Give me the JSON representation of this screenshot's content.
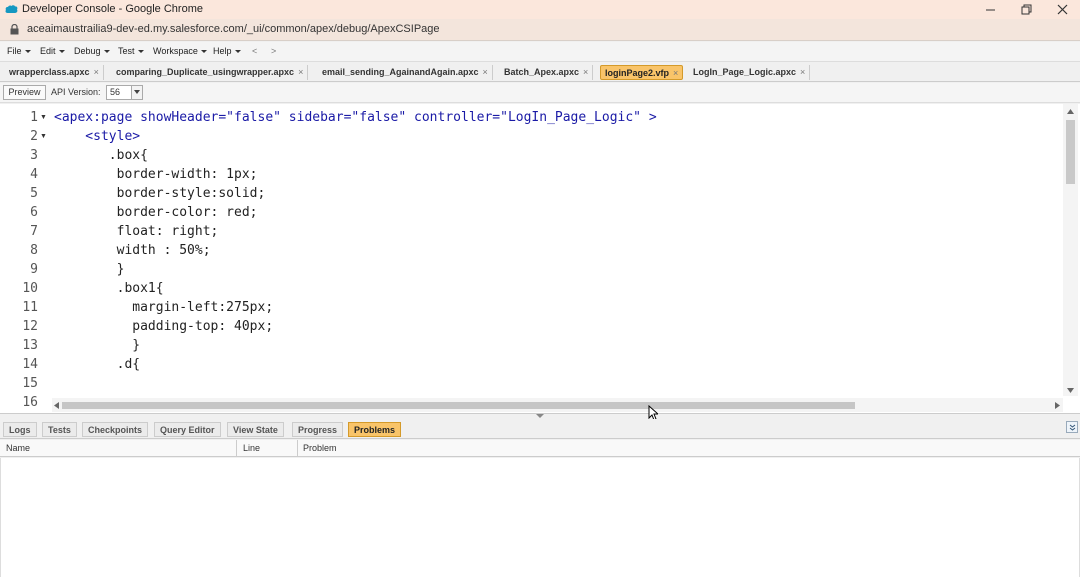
{
  "window": {
    "title": "Developer Console - Google Chrome",
    "url": "aceaimaustrailia9-dev-ed.my.salesforce.com/_ui/common/apex/debug/ApexCSIPage"
  },
  "menu": {
    "items": [
      "File",
      "Edit",
      "Debug",
      "Test",
      "Workspace",
      "Help"
    ],
    "back": "<",
    "forward": ">"
  },
  "tabs": [
    {
      "label": "wrapperclass.apxc",
      "active": false
    },
    {
      "label": "comparing_Duplicate_usingwrapper.apxc",
      "active": false
    },
    {
      "label": "email_sending_AgainandAgain.apxc",
      "active": false
    },
    {
      "label": "Batch_Apex.apxc",
      "active": false
    },
    {
      "label": "loginPage2.vfp",
      "active": true
    },
    {
      "label": "LogIn_Page_Logic.apxc",
      "active": false
    }
  ],
  "tab_close": "×",
  "toolbar": {
    "preview_label": "Preview",
    "api_label": "API Version:",
    "api_value": "56"
  },
  "editor": {
    "line_numbers": [
      "1",
      "2",
      "3",
      "4",
      "5",
      "6",
      "7",
      "8",
      "9",
      "10",
      "11",
      "12",
      "13",
      "14",
      "15",
      "16"
    ],
    "lines": [
      "<apex:page showHeader=\"false\" sidebar=\"false\" controller=\"LogIn_Page_Logic\" >",
      "    <style>",
      "       .box{",
      "        border-width: 1px;",
      "        border-style:solid;",
      "        border-color: red;",
      "        float: right;",
      "        width : 50%;",
      "        }",
      "        .box1{",
      "          margin-left:275px;",
      "          padding-top: 40px;",
      "          }",
      "        .d{",
      "",
      ""
    ]
  },
  "bottom_panel": {
    "tabs": [
      {
        "label": "Logs",
        "active": false
      },
      {
        "label": "Tests",
        "active": false
      },
      {
        "label": "Checkpoints",
        "active": false
      },
      {
        "label": "Query Editor",
        "active": false
      },
      {
        "label": "View State",
        "active": false
      },
      {
        "label": "Progress",
        "active": false
      },
      {
        "label": "Problems",
        "active": true
      }
    ],
    "columns": [
      "Name",
      "Line",
      "Problem"
    ]
  },
  "colors": {
    "active_tab": "#f9c469",
    "titlebar": "#fbe7dc",
    "code_text": "#1a1aa6"
  }
}
